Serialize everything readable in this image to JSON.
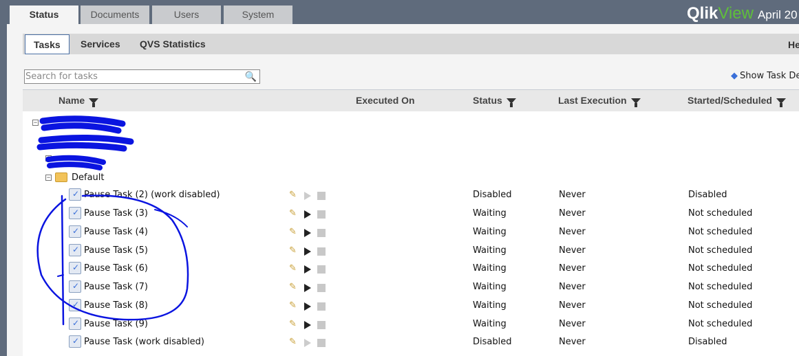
{
  "top_tabs": [
    {
      "label": "Status",
      "active": true
    },
    {
      "label": "Documents"
    },
    {
      "label": "Users"
    },
    {
      "label": "System"
    }
  ],
  "brand": {
    "qlik": "Qlik",
    "view": "View",
    "version": "April 20"
  },
  "sub_tabs": [
    {
      "label": "Tasks",
      "active": true
    },
    {
      "label": "Services"
    },
    {
      "label": "QVS Statistics"
    }
  ],
  "help_label": "He",
  "search": {
    "placeholder": "Search for tasks",
    "value": ""
  },
  "show_task_details": "Show Task De",
  "columns": {
    "name": "Name",
    "executed_on": "Executed On",
    "status": "Status",
    "last_execution": "Last Execution",
    "started_scheduled": "Started/Scheduled"
  },
  "folder": {
    "label": "Default"
  },
  "tasks": [
    {
      "name": "Pause Task (2) (work disabled)",
      "executed_on": "",
      "status": "Disabled",
      "last_execution": "Never",
      "started": "Disabled",
      "enabled": false
    },
    {
      "name": "Pause Task (3)",
      "executed_on": "",
      "status": "Waiting",
      "last_execution": "Never",
      "started": "Not scheduled",
      "enabled": true
    },
    {
      "name": "Pause Task (4)",
      "executed_on": "",
      "status": "Waiting",
      "last_execution": "Never",
      "started": "Not scheduled",
      "enabled": true
    },
    {
      "name": "Pause Task (5)",
      "executed_on": "",
      "status": "Waiting",
      "last_execution": "Never",
      "started": "Not scheduled",
      "enabled": true
    },
    {
      "name": "Pause Task (6)",
      "executed_on": "",
      "status": "Waiting",
      "last_execution": "Never",
      "started": "Not scheduled",
      "enabled": true
    },
    {
      "name": "Pause Task (7)",
      "executed_on": "",
      "status": "Waiting",
      "last_execution": "Never",
      "started": "Not scheduled",
      "enabled": true
    },
    {
      "name": "Pause Task (8)",
      "executed_on": "",
      "status": "Waiting",
      "last_execution": "Never",
      "started": "Not scheduled",
      "enabled": true
    },
    {
      "name": "Pause Task (9)",
      "executed_on": "",
      "status": "Waiting",
      "last_execution": "Never",
      "started": "Not scheduled",
      "enabled": true
    },
    {
      "name": "Pause Task (work disabled)",
      "executed_on": "",
      "status": "Disabled",
      "last_execution": "Never",
      "started": "Disabled",
      "enabled": false
    }
  ],
  "colors": {
    "header_bg": "#5f6b7c",
    "annotation": "#0a14e0",
    "brand_green": "#5fbf3a"
  }
}
